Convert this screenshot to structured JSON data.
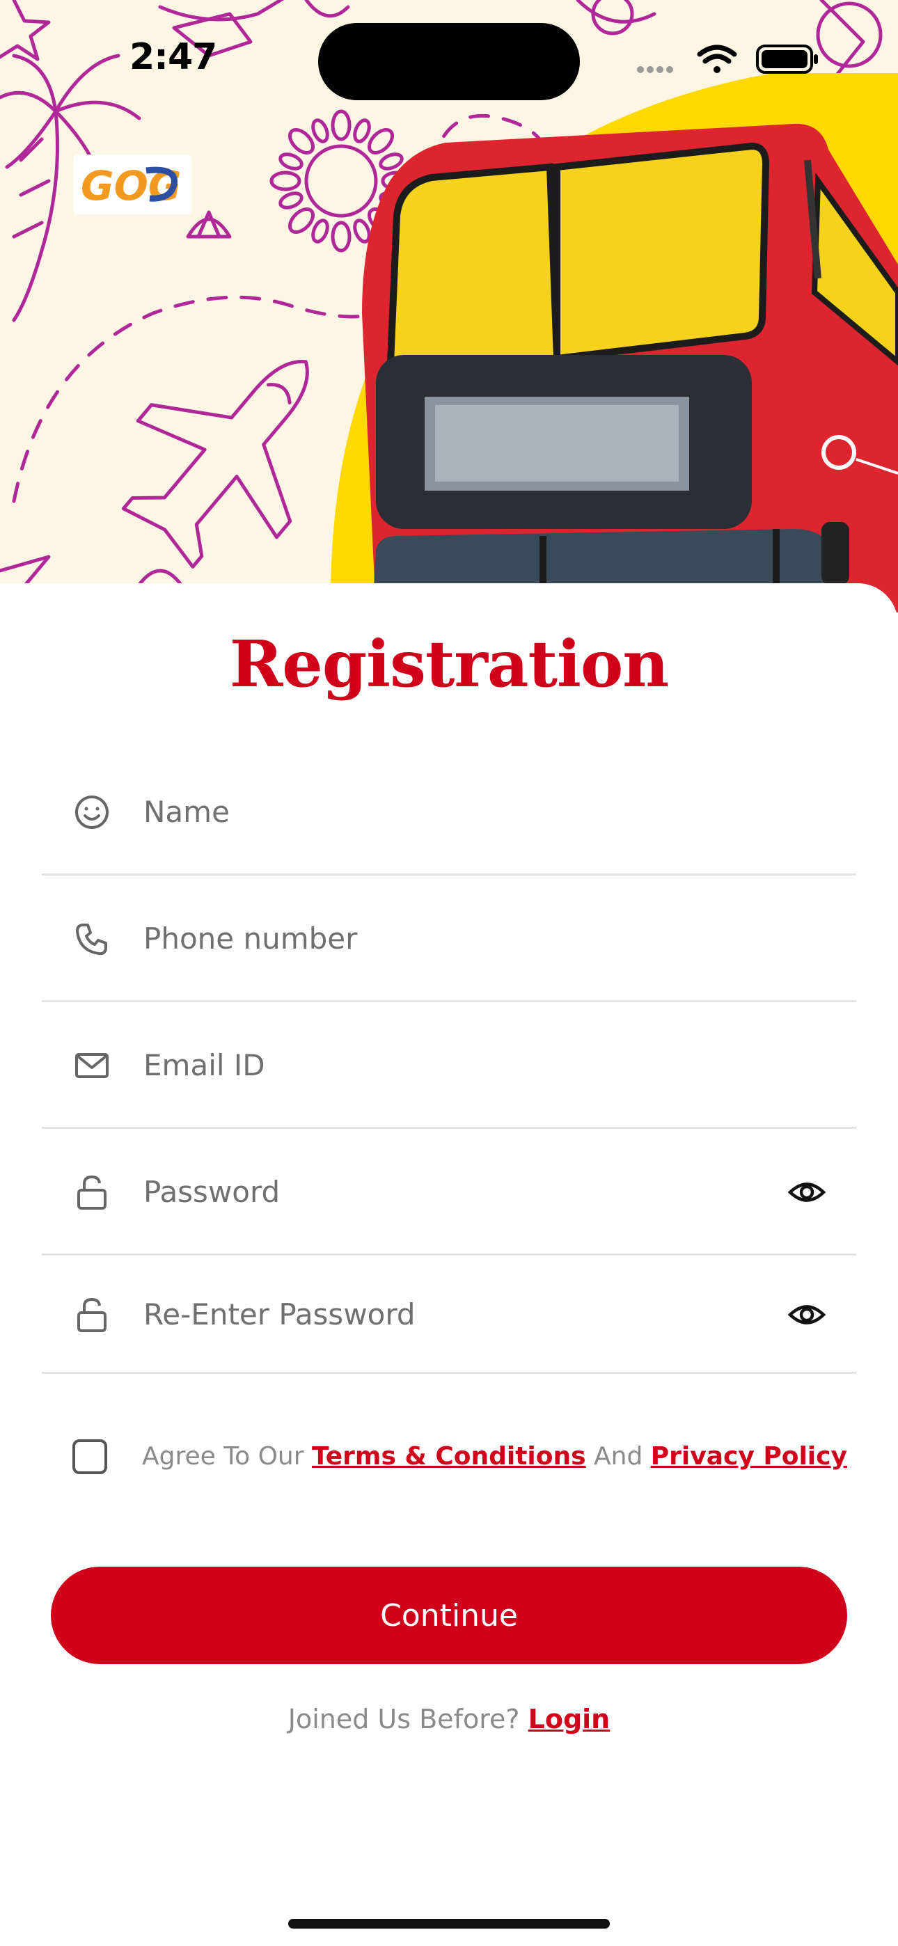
{
  "status_bar": {
    "time": "2:47"
  },
  "hero": {
    "logo_text": "GOG"
  },
  "form": {
    "title": "Registration",
    "fields": {
      "name": {
        "placeholder": "Name",
        "icon": "smiley-icon"
      },
      "phone": {
        "placeholder": "Phone number",
        "icon": "phone-icon"
      },
      "email": {
        "placeholder": "Email ID",
        "icon": "mail-icon"
      },
      "password": {
        "placeholder": "Password",
        "icon": "lock-icon",
        "toggle_icon": "eye-icon"
      },
      "reenter_password": {
        "placeholder": "Re-Enter Password",
        "icon": "lock-icon",
        "toggle_icon": "eye-icon"
      }
    },
    "agree": {
      "checked": false,
      "prefix": "Agree To Our",
      "terms_link": "Terms & Conditions",
      "middle": "And",
      "privacy_link": "Privacy Policy"
    },
    "continue_label": "Continue",
    "login_prompt": "Joined Us Before?",
    "login_link": "Login"
  },
  "colors": {
    "accent": "#d0021b",
    "hero_background": "#fdf6e4",
    "doodle": "#b0279a",
    "sun_yellow": "#ffd900",
    "bus_red": "#dd2530"
  }
}
